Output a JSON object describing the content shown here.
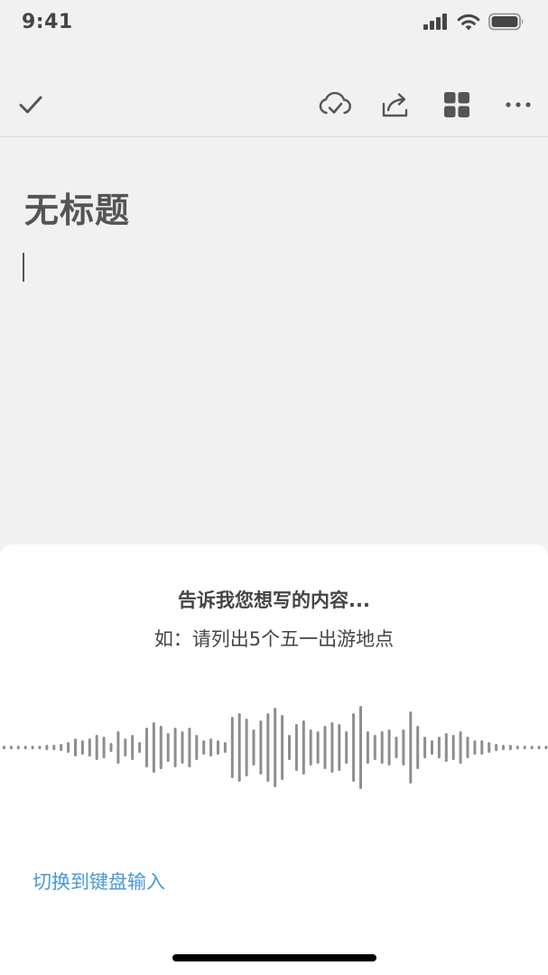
{
  "status_bar": {
    "time": "9:41",
    "icons": [
      "cellular-signal-icon",
      "wifi-icon",
      "battery-icon"
    ]
  },
  "toolbar": {
    "left_icon": "checkmark-icon",
    "right_icons": [
      "cloud-sync-check-icon",
      "share-icon",
      "grid-view-icon",
      "more-options-icon"
    ]
  },
  "document": {
    "title": "无标题",
    "body": ""
  },
  "voice_sheet": {
    "prompt": "告诉我您想写的内容...",
    "example": "如：请列出5个五一出游地点",
    "switch_to_keyboard_label": "切换到键盘输入",
    "waveform_levels": [
      2,
      2,
      2,
      2,
      2,
      2,
      3,
      3,
      4,
      6,
      10,
      8,
      10,
      14,
      12,
      5,
      18,
      10,
      14,
      6,
      22,
      28,
      24,
      16,
      22,
      18,
      22,
      14,
      8,
      10,
      8,
      6,
      34,
      38,
      32,
      20,
      30,
      38,
      44,
      36,
      14,
      26,
      30,
      20,
      18,
      24,
      28,
      26,
      18,
      38,
      46,
      18,
      14,
      18,
      20,
      12,
      20,
      40,
      24,
      12,
      8,
      12,
      16,
      14,
      18,
      12,
      8,
      8,
      6,
      4,
      3,
      3,
      2,
      2,
      2,
      2,
      2
    ]
  },
  "colors": {
    "background": "#f1f1f1",
    "sheet": "#ffffff",
    "icon": "#555555",
    "waveform": "#8e8e8e",
    "link": "#4a98d8"
  }
}
